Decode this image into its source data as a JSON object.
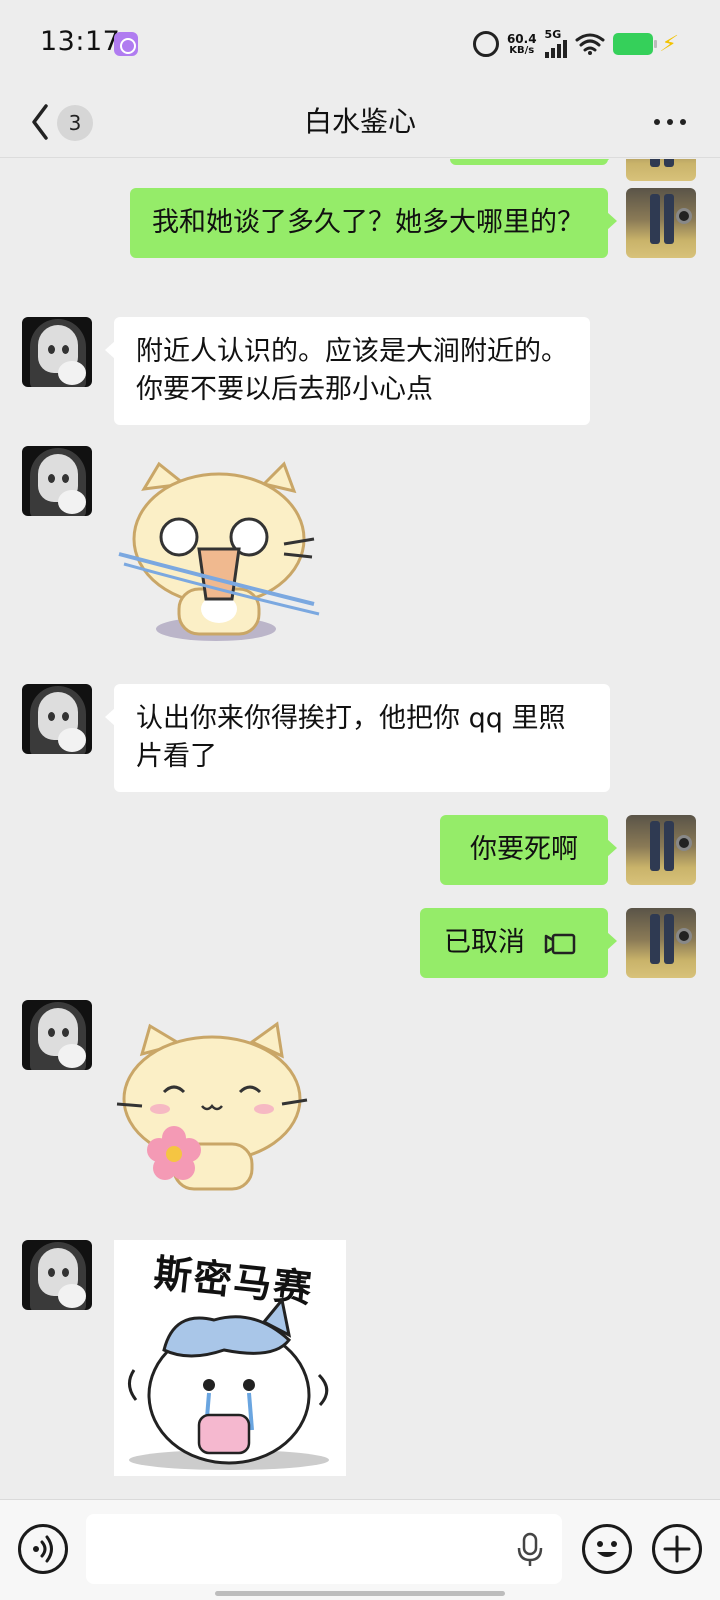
{
  "status_bar": {
    "time": "13:17",
    "net_speed_value": "60.4",
    "net_speed_unit": "KB/s",
    "network_type": "5G",
    "battery_color": "#35D05A"
  },
  "header": {
    "unread_count": "3",
    "title": "白水鉴心"
  },
  "messages": [
    {
      "sender": "self",
      "type": "text",
      "text": "我和她谈了多久了？她多大哪里的？"
    },
    {
      "sender": "other",
      "type": "text",
      "text": "附近人认识的。应该是大涧附近的。你要不要以后去那小心点"
    },
    {
      "sender": "other",
      "type": "sticker",
      "sticker": "cat-startled-sticker"
    },
    {
      "sender": "other",
      "type": "text",
      "text": "认出你来你得挨打，他把你 qq 里照片看了"
    },
    {
      "sender": "self",
      "type": "text",
      "text": "你要死啊"
    },
    {
      "sender": "self",
      "type": "call",
      "text": "已取消",
      "icon": "video-call-icon"
    },
    {
      "sender": "other",
      "type": "sticker",
      "sticker": "cat-flower-sticker"
    },
    {
      "sender": "other",
      "type": "sticker",
      "sticker": "crying-cat-sticker",
      "caption": "斯密马赛"
    }
  ],
  "input_bar": {
    "placeholder": "",
    "accent": "#95EC69"
  }
}
